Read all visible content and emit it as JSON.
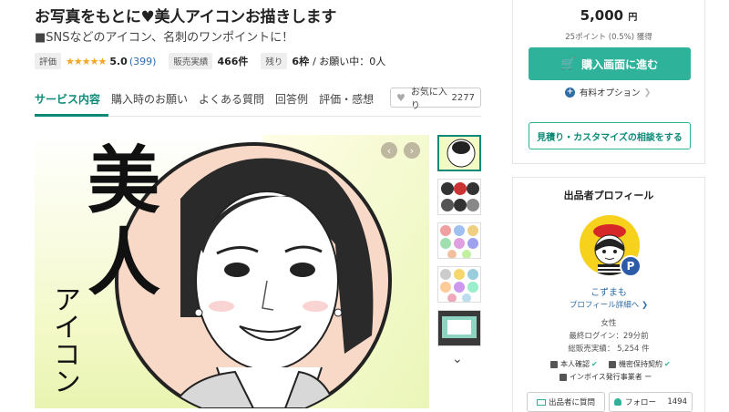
{
  "header": {
    "title": "お写真をもとに♥美人アイコンお描きします",
    "subtitle": "■SNSなどのアイコン、名刺のワンポイントに！",
    "rating_tag": "評価",
    "stars": "★★★★★",
    "rating": "5.0",
    "rating_count": "(399)",
    "sales_tag": "販売実績",
    "sales": "466件",
    "remaining_tag": "残り",
    "remaining": "6枠",
    "requests": "/ お願い中：0人"
  },
  "tabs": [
    {
      "label": "サービス内容",
      "active": true
    },
    {
      "label": "購入時のお願い",
      "active": false
    },
    {
      "label": "よくある質問",
      "active": false
    },
    {
      "label": "回答例",
      "active": false
    },
    {
      "label": "評価・感想",
      "active": false
    }
  ],
  "favorite": {
    "label": "お気に入り",
    "count": "2277"
  },
  "hero": {
    "big_text_1": "美",
    "big_text_2": "人",
    "side_text": "アイコン"
  },
  "nav": {
    "prev": "‹",
    "next": "›",
    "down": "⌄"
  },
  "purchase": {
    "price": "5,000",
    "yen": "円",
    "points": "25ポイント (0.5%) 獲得",
    "buy_label": "購入画面に進む",
    "option_label": "有料オプション",
    "consult_label": "見積り・カスタマイズの相談をする"
  },
  "profile": {
    "title": "出品者プロフィール",
    "name": "こずまも",
    "detail_link": "プロフィール詳細へ ❯",
    "gender": "女性",
    "last_login": "最終ログイン：29分前",
    "total_sales": "総販売実績： 5,254 件",
    "id_verified": "本人確認",
    "nda": "機密保持契約",
    "invoice": "インボイス発行事業者 ー",
    "message_label": "出品者に質問",
    "follow_label": "フォロー",
    "follow_count": "1494",
    "badge": "P"
  },
  "colors": {
    "accent": "#2eb39a",
    "accent_dark": "#0b8b77",
    "link": "#2d6ea8",
    "star": "#f5a623",
    "avatar_bg": "#f7d21c"
  }
}
